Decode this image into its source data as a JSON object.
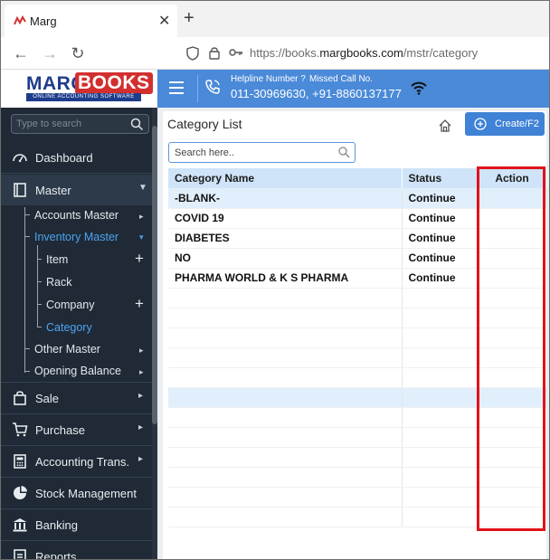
{
  "browser": {
    "tab_title": "Marg",
    "url_prefix": "https://books.",
    "url_domain": "margbooks.com",
    "url_path": "/mstr/category"
  },
  "header": {
    "logo_marg": "MARG",
    "logo_books": "BOOKS",
    "logo_tagline": "ONLINE ACCOUNTING SOFTWARE",
    "helpline_label": "Helpline Number ?",
    "missed_call_label": "Missed Call No.",
    "helpline_numbers": "011-30969630, +91-8860137177",
    "accent_color": "#4a8ad8"
  },
  "sidebar": {
    "search_placeholder": "Type to search",
    "items": [
      {
        "label": "Dashboard",
        "icon": "dashboard-icon"
      },
      {
        "label": "Master",
        "icon": "master-book-icon"
      },
      {
        "label": "Sale",
        "icon": "shopping-bag-icon"
      },
      {
        "label": "Purchase",
        "icon": "cart-icon"
      },
      {
        "label": "Accounting Trans.",
        "icon": "calculator-icon"
      },
      {
        "label": "Stock Management",
        "icon": "pie-chart-icon"
      },
      {
        "label": "Banking",
        "icon": "bank-icon"
      },
      {
        "label": "Reports",
        "icon": "report-icon"
      }
    ],
    "master_sub": {
      "accounts_master": "Accounts Master",
      "inventory_master": "Inventory Master",
      "item": "Item",
      "rack": "Rack",
      "company": "Company",
      "category": "Category",
      "other_master": "Other Master",
      "opening_balance": "Opening Balance"
    }
  },
  "main": {
    "title": "Category List",
    "create_button": "Create/F2",
    "search_placeholder": "Search here..",
    "columns": [
      "Category Name",
      "Status",
      "Action"
    ],
    "rows": [
      {
        "name": "-BLANK-",
        "status": "Continue"
      },
      {
        "name": "COVID 19",
        "status": "Continue"
      },
      {
        "name": "DIABETES",
        "status": "Continue"
      },
      {
        "name": "NO",
        "status": "Continue"
      },
      {
        "name": "PHARMA WORLD & K S PHARMA",
        "status": "Continue"
      }
    ],
    "empty_rows": 12,
    "highlight_color": "#e0131a"
  }
}
